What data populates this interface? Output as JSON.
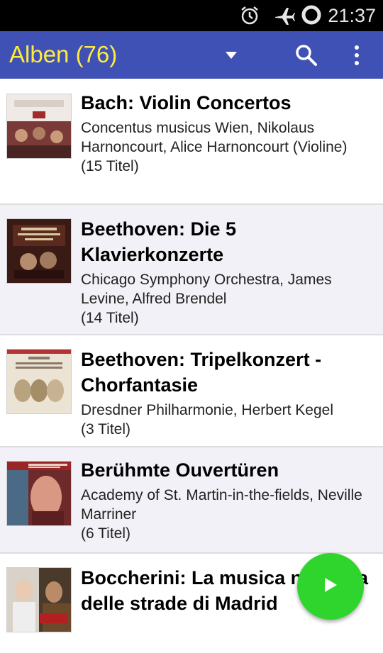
{
  "status_bar": {
    "time": "21:37",
    "icons": [
      "alarm-icon",
      "airplane-mode-icon",
      "loading-circle-icon"
    ]
  },
  "app_bar": {
    "title": "Alben (76)",
    "dropdown_icon": "dropdown-triangle-icon",
    "search_icon": "search-icon",
    "menu_icon": "overflow-menu-icon",
    "background": "#3f51b5",
    "title_color": "#ffeb3b"
  },
  "albums": [
    {
      "title": "Bach: Violin Concertos",
      "artists": "Concentus musicus Wien, Nikolaus Harnoncourt, Alice Harnoncourt (Violine)",
      "count": "(15 Titel)"
    },
    {
      "title": "Beethoven: Die 5 Klavierkonzerte",
      "artists": "Chicago Symphony Orchestra, James Levine, Alfred Brendel",
      "count": "(14 Titel)"
    },
    {
      "title": "Beethoven: Tripelkonzert - Chorfantasie",
      "artists": "Dresdner Philharmonie, Herbert Kegel",
      "count": "(3 Titel)"
    },
    {
      "title": "Berühmte Ouvertüren",
      "artists": "Academy of St. Martin-in-the-fields, Neville Marriner",
      "count": "(6 Titel)"
    },
    {
      "title": "Boccherini: La musica notturna delle strade di Madrid",
      "artists": "",
      "count": ""
    }
  ],
  "fab": {
    "icon": "play-icon",
    "color": "#2fd52c"
  }
}
